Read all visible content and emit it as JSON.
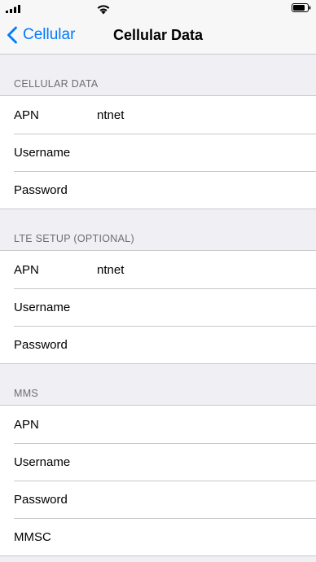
{
  "nav": {
    "back_label": "Cellular",
    "title": "Cellular Data"
  },
  "sections": [
    {
      "header": "CELLULAR DATA",
      "rows": [
        {
          "label": "APN",
          "value": "ntnet"
        },
        {
          "label": "Username",
          "value": ""
        },
        {
          "label": "Password",
          "value": ""
        }
      ]
    },
    {
      "header": "LTE SETUP (OPTIONAL)",
      "rows": [
        {
          "label": "APN",
          "value": "ntnet"
        },
        {
          "label": "Username",
          "value": ""
        },
        {
          "label": "Password",
          "value": ""
        }
      ]
    },
    {
      "header": "MMS",
      "rows": [
        {
          "label": "APN",
          "value": ""
        },
        {
          "label": "Username",
          "value": ""
        },
        {
          "label": "Password",
          "value": ""
        },
        {
          "label": "MMSC",
          "value": ""
        }
      ]
    }
  ],
  "colors": {
    "accent": "#007aff",
    "background": "#efeff4",
    "separator": "#c8c7cc",
    "section_header_text": "#6d6d72"
  },
  "icons": {
    "signal": "cellular-signal-icon",
    "wifi": "wifi-icon",
    "battery": "battery-icon",
    "back": "chevron-left-icon"
  }
}
